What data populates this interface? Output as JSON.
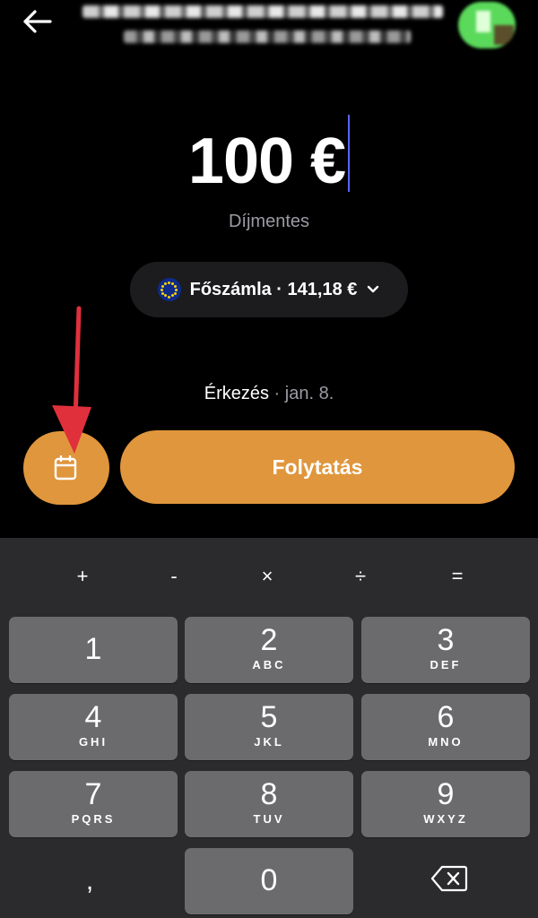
{
  "amount": {
    "text": "100 €"
  },
  "fee": "Díjmentes",
  "account": {
    "label": "Főszámla · 141,18 €",
    "icon": "eu-flag-icon"
  },
  "arrival": {
    "label": "Érkezés",
    "separator": " · ",
    "date": "jan. 8."
  },
  "actions": {
    "continue_label": "Folytatás",
    "schedule_icon": "calendar-icon"
  },
  "colors": {
    "accent": "#e0963c",
    "background": "#000000",
    "keypad_bg": "#2b2b2d",
    "key_bg": "#6b6b6d",
    "caret": "#5865f2",
    "annotation_arrow": "#e0303c"
  },
  "keypad": {
    "operators": [
      "+",
      "-",
      "×",
      "÷",
      "="
    ],
    "keys": [
      {
        "digit": "1",
        "letters": ""
      },
      {
        "digit": "2",
        "letters": "ABC"
      },
      {
        "digit": "3",
        "letters": "DEF"
      },
      {
        "digit": "4",
        "letters": "GHI"
      },
      {
        "digit": "5",
        "letters": "JKL"
      },
      {
        "digit": "6",
        "letters": "MNO"
      },
      {
        "digit": "7",
        "letters": "PQRS"
      },
      {
        "digit": "8",
        "letters": "TUV"
      },
      {
        "digit": "9",
        "letters": "WXYZ"
      },
      {
        "digit": "0",
        "letters": ""
      }
    ],
    "comma": ",",
    "backspace_icon": "backspace-icon"
  }
}
